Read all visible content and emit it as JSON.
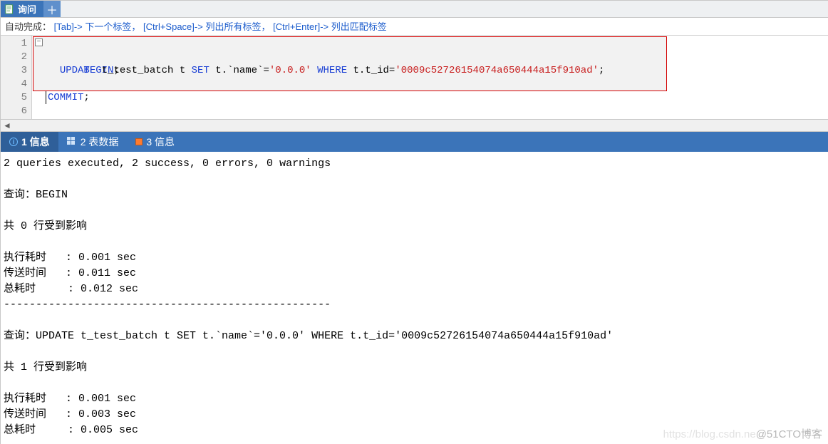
{
  "tabs": {
    "active_label": "询问",
    "add_symbol": "＋"
  },
  "hint": {
    "prefix": "自动完成：",
    "p1_key": "[Tab]",
    "p1_txt": "-> 下一个标签，",
    "p2_key": "[Ctrl+Space]",
    "p2_txt": "-> 列出所有标签，",
    "p3_key": "[Ctrl+Enter]",
    "p3_txt": "-> 列出匹配标签"
  },
  "editor": {
    "line_numbers": [
      "1",
      "2",
      "3",
      "4",
      "5",
      "6"
    ],
    "fold_glyph": "−",
    "l1": {
      "kw": "BEGIN",
      "tail": ";"
    },
    "l3": {
      "indent": "  ",
      "kw1": "UPDATE",
      "t1": " t_test_batch t ",
      "kw2": "SET",
      "t2": " t.`name`=",
      "s1": "'0.0.0'",
      "sp": " ",
      "kw3": "WHERE",
      "t3": " t.t_id=",
      "s2": "'0009c52726154074a650444a15f910ad'",
      "tail": ";"
    },
    "l5": {
      "kw": "COMMIT",
      "tail": ";"
    }
  },
  "hscroll_glyph": "◄",
  "result_tabs": {
    "t1": "1 信息",
    "t2": "2 表数据",
    "t3": "3 信息"
  },
  "out": {
    "summary": "2 queries executed, 2 success, 0 errors, 0 warnings",
    "q1_label": "查询：BEGIN",
    "q1_rows": "共 0 行受到影响",
    "q1_t1": "执行耗时   : 0.001 sec",
    "q1_t2": "传送时间   : 0.011 sec",
    "q1_t3": "总耗时     : 0.012 sec",
    "divider": "---------------------------------------------------",
    "q2_label": "查询：UPDATE t_test_batch t SET t.`name`='0.0.0' WHERE t.t_id='0009c52726154074a650444a15f910ad'",
    "q2_rows": "共 1 行受到影响",
    "q2_t1": "执行耗时   : 0.001 sec",
    "q2_t2": "传送时间   : 0.003 sec",
    "q2_t3": "总耗时     : 0.005 sec"
  },
  "watermark": {
    "faint": "https://blog.csdn.ne",
    "solid": "@51CTO博客"
  }
}
